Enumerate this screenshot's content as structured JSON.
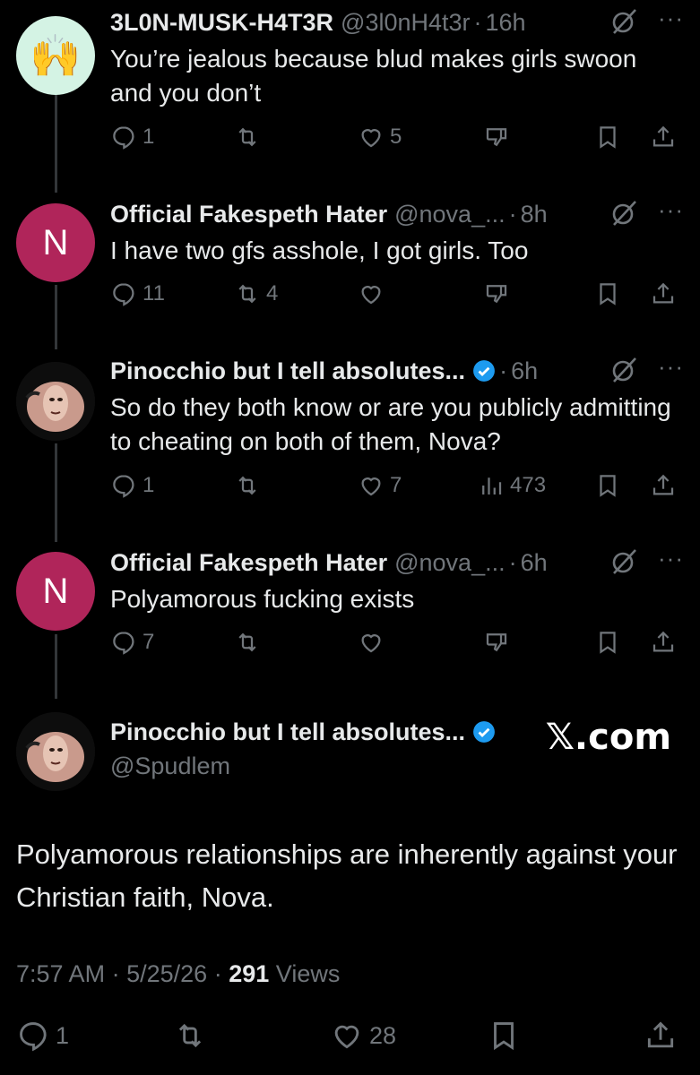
{
  "tweets": [
    {
      "name": "3L0N-MUSK-H4T3R",
      "handle": "@3l0nH4t3r",
      "time": "16h",
      "avatar_emoji": "🙌",
      "text": "You’re jealous because blud makes girls swoon and you don’t",
      "replies": "1",
      "reposts": "",
      "likes": "5",
      "views": ""
    },
    {
      "name": "Official Fakespeth Hater",
      "handle": "@nova_...",
      "time": "8h",
      "avatar_letter": "N",
      "text": "I have two gfs asshole, I got girls. Too",
      "replies": "11",
      "reposts": "4",
      "likes": "",
      "views": ""
    },
    {
      "name": "Pinocchio but I tell absolutes...",
      "handle": "",
      "time": "6h",
      "text": "So do they both know or are you publicly admitting to cheating on both of them, Nova?",
      "replies": "1",
      "reposts": "",
      "likes": "7",
      "views": "473"
    },
    {
      "name": "Official Fakespeth Hater",
      "handle": "@nova_...",
      "time": "6h",
      "avatar_letter": "N",
      "text": "Polyamorous fucking exists",
      "replies": "7",
      "reposts": "",
      "likes": "",
      "views": ""
    }
  ],
  "main": {
    "name": "Pinocchio but I tell absolutes...",
    "handle": "@Spudlem",
    "watermark": "𝕏.com",
    "text": "Polyamorous relationships are inherently against your Christian faith, Nova.",
    "time": "7:57 AM",
    "date": "5/25/26",
    "views_count": "291",
    "views_label": "Views",
    "replies": "1",
    "likes": "28"
  },
  "ui": {
    "separator": "·",
    "more": "···"
  },
  "colors": {
    "background": "#000000",
    "verified": "#1d9bf0",
    "muted": "#71767b",
    "avatar_n": "#b0255a"
  }
}
